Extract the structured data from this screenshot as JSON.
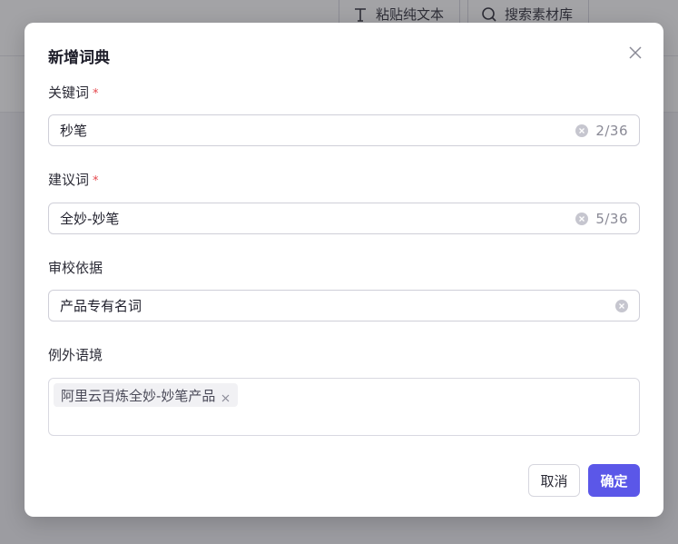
{
  "background": {
    "toolbar": {
      "paste_label": "粘贴纯文本",
      "search_label": "搜索素材库"
    }
  },
  "modal": {
    "title": "新增词典",
    "keyword": {
      "label": "关键词",
      "required_mark": "*",
      "value": "秒笔",
      "counter": "2/36"
    },
    "suggestion": {
      "label": "建议词",
      "required_mark": "*",
      "value": "全妙-妙笔",
      "counter": "5/36"
    },
    "basis": {
      "label": "审校依据",
      "value": "产品专有名词"
    },
    "exception": {
      "label": "例外语境",
      "tags": [
        "阿里云百炼全妙-妙笔产品"
      ]
    },
    "buttons": {
      "cancel": "取消",
      "confirm": "确定"
    }
  },
  "colors": {
    "primary": "#5b57e8",
    "required": "#e5484d"
  },
  "icons": {
    "close": "close-icon",
    "clear": "clear-circle-icon",
    "text": "text-format-icon",
    "search": "search-icon"
  }
}
